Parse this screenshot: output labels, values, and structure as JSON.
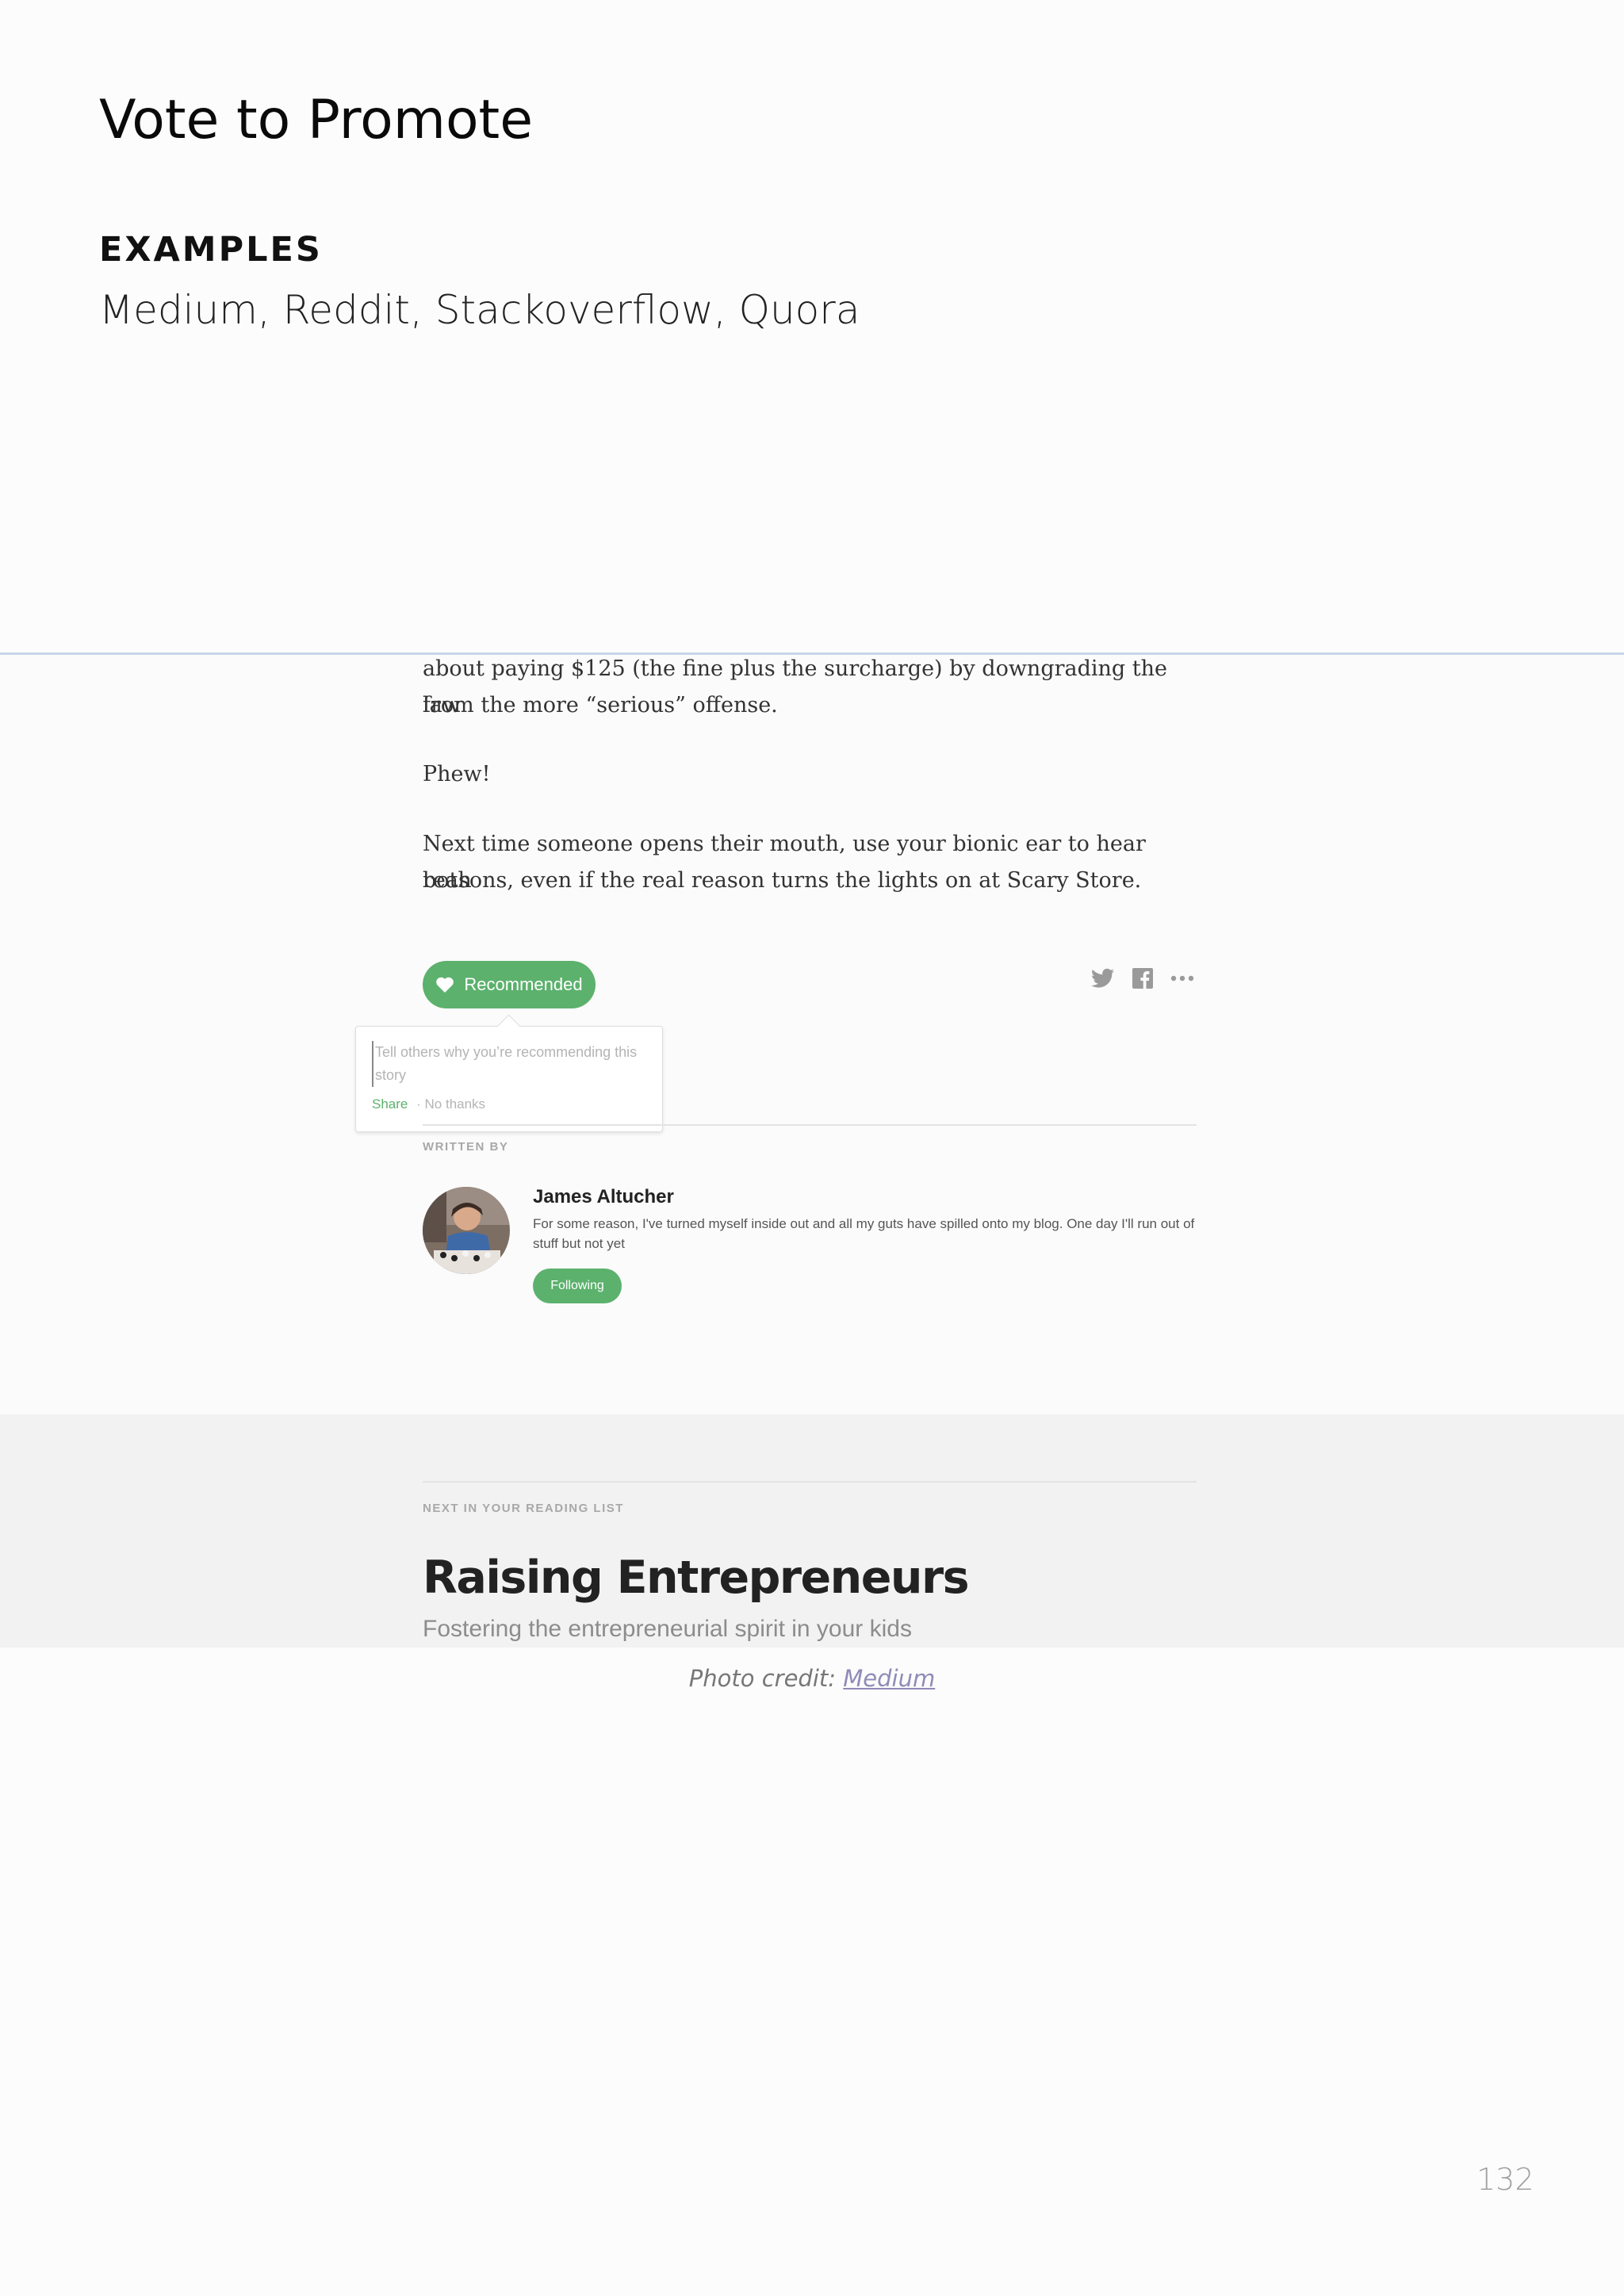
{
  "page": {
    "title": "Vote to Promote",
    "examples_heading": "EXAMPLES",
    "examples_list": "Medium, Reddit, Stackoverflow, Quora",
    "photo_credit_prefix": "Photo credit: ",
    "photo_credit_link": "Medium",
    "page_number": "132"
  },
  "article": {
    "paragraph_1_top": "about paying $125 (the fine plus the surcharge) by downgrading the law",
    "paragraph_1_bottom": "from the more “serious” offense.",
    "paragraph_2": "Phew!",
    "paragraph_3_line_1": "Next time someone opens their mouth, use your bionic ear to hear both",
    "paragraph_3_line_2": "reasons, even if the real reason turns the lights on at Scary Store."
  },
  "actions": {
    "recommend_label": "Recommended",
    "icons": [
      "heart-icon",
      "twitter-icon",
      "facebook-icon",
      "more-icon"
    ],
    "accent_color": "#5cb16d"
  },
  "popover": {
    "placeholder": "Tell others why you’re recommending this story",
    "share_label": "Share",
    "separator": "·",
    "dismiss_label": "No thanks"
  },
  "author": {
    "section_label": "WRITTEN BY",
    "name": "James Altucher",
    "bio": "For some reason, I've turned myself inside out and all my guts have spilled onto my blog. One day I'll run out of stuff but not yet",
    "follow_label": "Following"
  },
  "next_story": {
    "section_label": "NEXT IN YOUR READING LIST",
    "title": "Raising Entrepreneurs",
    "subtitle": "Fostering the entrepreneurial spirit in your kids"
  }
}
